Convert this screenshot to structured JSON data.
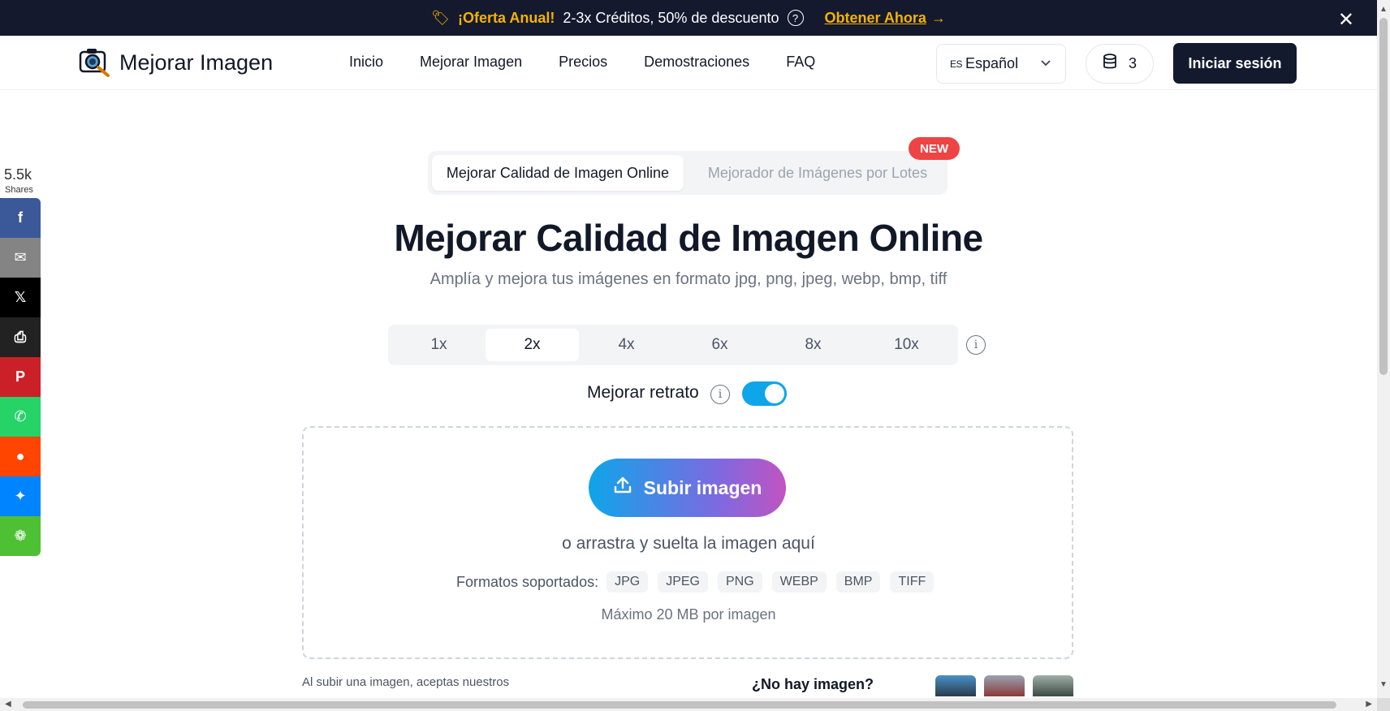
{
  "promo": {
    "offer": "¡Oferta Anual!",
    "description": "2-3x Créditos, 50% de descuento",
    "help": "?",
    "cta": "Obtener Ahora",
    "cta_arrow": "→",
    "close": "✕"
  },
  "header": {
    "logo_text": "Mejorar Imagen",
    "nav": [
      "Inicio",
      "Mejorar Imagen",
      "Precios",
      "Demostraciones",
      "FAQ"
    ],
    "language_code": "ES",
    "language": "Español",
    "credits": "3",
    "login": "Iniciar sesión"
  },
  "social": {
    "count": "5.5k",
    "label": "Shares",
    "buttons": [
      {
        "name": "facebook",
        "glyph": "f",
        "color": "#3b5998"
      },
      {
        "name": "email",
        "glyph": "✉",
        "color": "#848484"
      },
      {
        "name": "x",
        "glyph": "𝕏",
        "color": "#000000"
      },
      {
        "name": "print",
        "glyph": "⎙",
        "color": "#222222"
      },
      {
        "name": "pinterest",
        "glyph": "P",
        "color": "#cb2027"
      },
      {
        "name": "whatsapp",
        "glyph": "✆",
        "color": "#25d366"
      },
      {
        "name": "reddit",
        "glyph": "●",
        "color": "#ff4500"
      },
      {
        "name": "messenger",
        "glyph": "✦",
        "color": "#0084ff"
      },
      {
        "name": "wechat",
        "glyph": "❁",
        "color": "#4ec034"
      }
    ]
  },
  "mode_tabs": {
    "active": "Mejorar Calidad de Imagen Online",
    "other": "Mejorador de Imágenes por Lotes",
    "badge": "NEW"
  },
  "hero": {
    "title": "Mejorar Calidad de Imagen Online",
    "subtitle": "Amplía y mejora tus imágenes en formato jpg, png, jpeg, webp, bmp, tiff"
  },
  "scales": {
    "options": [
      "1x",
      "2x",
      "4x",
      "6x",
      "8x",
      "10x"
    ],
    "selected": "2x",
    "info": "i"
  },
  "portrait": {
    "label": "Mejorar retrato",
    "info": "i",
    "enabled": true
  },
  "upload": {
    "button": "Subir imagen",
    "drag_text": "o arrastra y suelta la imagen aquí",
    "formats_label": "Formatos soportados:",
    "formats": [
      "JPG",
      "JPEG",
      "PNG",
      "WEBP",
      "BMP",
      "TIFF"
    ],
    "max_size": "Máximo 20 MB por imagen"
  },
  "footer_row": {
    "terms": "Al subir una imagen, aceptas nuestros",
    "no_image": "¿No hay imagen?"
  },
  "colors": {
    "banner_bg": "#14192e",
    "accent_yellow": "#f5b300",
    "login_bg": "#131a2e",
    "toggle_on": "#0ea5e9",
    "new_badge": "#ef4444"
  }
}
